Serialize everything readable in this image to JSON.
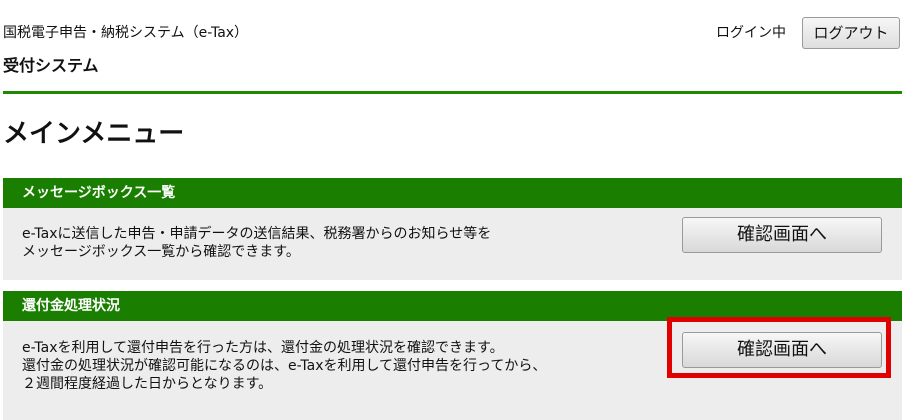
{
  "header": {
    "system_name": "国税電子申告・納税システム（e-Tax）",
    "sub_system": "受付システム",
    "login_status": "ログイン中",
    "logout_label": "ログアウト"
  },
  "main": {
    "title": "メインメニュー",
    "sections": [
      {
        "heading": "メッセージボックス一覧",
        "lines": [
          "e-Taxに送信した申告・申請データの送信結果、税務署からのお知らせ等を",
          "メッセージボックス一覧から確認できます。"
        ],
        "button_label": "確認画面へ"
      },
      {
        "heading": "還付金処理状況",
        "lines": [
          "e-Taxを利用して還付申告を行った方は、還付金の処理状況を確認できます。",
          "還付金の処理状況が確認可能になるのは、e-Taxを利用して還付申告を行ってから、",
          "２週間程度経過した日からとなります。"
        ],
        "button_label": "確認画面へ",
        "highlighted": true
      }
    ]
  },
  "colors": {
    "accent_green": "#1a7f00",
    "highlight_red": "#e00000",
    "section_background": "#ededed"
  }
}
